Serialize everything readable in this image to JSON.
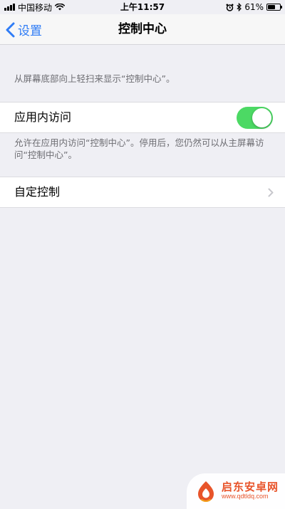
{
  "status_bar": {
    "carrier": "中国移动",
    "time": "上午11:57",
    "battery": "61%",
    "battery_level": 0.61
  },
  "nav": {
    "back_label": "设置",
    "title": "控制中心"
  },
  "header_note": "从屏幕底部向上轻扫来显示“控制中心”。",
  "access_cell": {
    "label": "应用内访问",
    "toggle_on": true,
    "note": "允许在应用内访问“控制中心”。停用后，您仍然可以从主屏幕访问“控制中心”。"
  },
  "customize_cell": {
    "label": "自定控制"
  },
  "watermark": {
    "name": "启东安卓网",
    "url": "www.qdtldq.com"
  },
  "colors": {
    "accent": "#2f7cf6",
    "toggle_on": "#4cd964",
    "background": "#efeff4",
    "watermark": "#e8542a"
  }
}
